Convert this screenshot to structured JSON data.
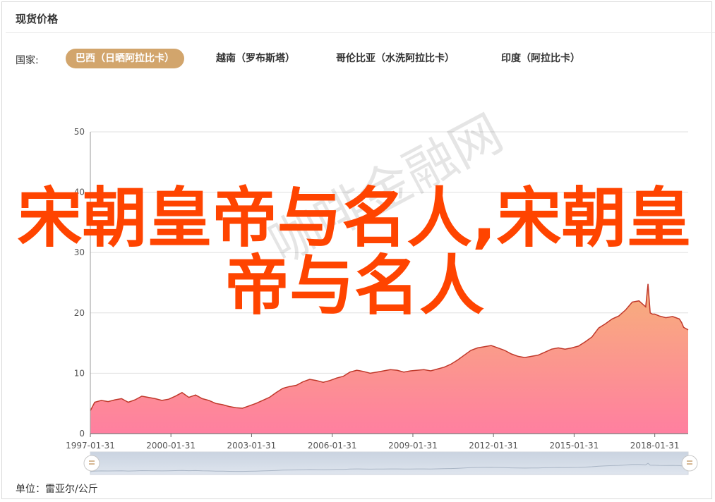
{
  "title": "现货价格",
  "country_label": "国家:",
  "countries": [
    {
      "label": "巴西（日晒阿拉比卡）",
      "active": true
    },
    {
      "label": "越南（罗布斯塔）",
      "active": false
    },
    {
      "label": "哥伦比亚（水洗阿拉比卡）",
      "active": false
    },
    {
      "label": "印度（阿拉比卡）",
      "active": false
    }
  ],
  "unit": "单位：雷亚尔/公斤",
  "watermark": "咖啡金融网",
  "overlay_text": "宋朝皇帝与名人,宋朝皇帝与名人",
  "colors": {
    "accent": "#d2a56c",
    "line": "#c0392b",
    "fill_top": "#f7b07a",
    "fill_bottom": "#ff7fa0",
    "overlay": "#ff4400"
  },
  "chart_data": {
    "type": "area",
    "title": "",
    "xlabel": "",
    "ylabel": "",
    "ylim": [
      0,
      50
    ],
    "yticks": [
      0,
      10,
      20,
      30,
      40,
      50
    ],
    "xlim": [
      "1997-01-31",
      "2019-04-30"
    ],
    "xticks": [
      "1997-01-31",
      "2000-01-31",
      "2003-01-31",
      "2006-01-31",
      "2009-01-31",
      "2012-01-31",
      "2015-01-31",
      "2018-01-31"
    ],
    "grid": true,
    "series": [
      {
        "x": [
          "1997-01-31",
          "1997-03-31",
          "1997-06-30",
          "1997-09-30",
          "1997-12-31",
          "1998-03-31",
          "1998-06-30",
          "1998-09-30",
          "1998-12-31",
          "1999-03-31",
          "1999-06-30",
          "1999-09-30",
          "1999-12-31",
          "2000-03-31",
          "2000-06-30",
          "2000-09-30",
          "2000-12-31",
          "2001-03-31",
          "2001-06-30",
          "2001-09-30",
          "2001-12-31",
          "2002-03-31",
          "2002-06-30",
          "2002-09-30",
          "2002-12-31",
          "2003-03-31",
          "2003-06-30",
          "2003-09-30",
          "2003-12-31",
          "2004-03-31",
          "2004-06-30",
          "2004-09-30",
          "2004-12-31",
          "2005-03-31",
          "2005-06-30",
          "2005-09-30",
          "2005-12-31",
          "2006-03-31",
          "2006-06-30",
          "2006-09-30",
          "2006-12-31",
          "2007-03-31",
          "2007-06-30",
          "2007-09-30",
          "2007-12-31",
          "2008-03-31",
          "2008-06-30",
          "2008-09-30",
          "2008-12-31",
          "2009-03-31",
          "2009-06-30",
          "2009-09-30",
          "2009-12-31",
          "2010-03-31",
          "2010-06-30",
          "2010-09-30",
          "2010-12-31",
          "2011-03-31",
          "2011-06-30",
          "2011-09-30",
          "2011-12-31",
          "2012-03-31",
          "2012-06-30",
          "2012-09-30",
          "2012-12-31",
          "2013-03-31",
          "2013-06-30",
          "2013-09-30",
          "2013-12-31",
          "2014-03-31",
          "2014-06-30",
          "2014-09-30",
          "2014-12-31",
          "2015-03-31",
          "2015-06-30",
          "2015-09-30",
          "2015-12-31",
          "2016-03-31",
          "2016-06-30",
          "2016-09-30",
          "2016-12-31",
          "2017-03-31",
          "2017-06-30",
          "2017-09-30",
          "2017-10-31",
          "2017-11-30",
          "2017-12-31",
          "2018-01-31",
          "2018-03-31",
          "2018-06-30",
          "2018-09-30",
          "2018-12-31",
          "2019-01-31",
          "2019-02-28",
          "2019-03-31",
          "2019-04-30"
        ],
        "values": [
          3.8,
          5.2,
          5.5,
          5.3,
          5.6,
          5.8,
          5.2,
          5.6,
          6.2,
          6.0,
          5.8,
          5.5,
          5.7,
          6.2,
          6.8,
          6.0,
          6.4,
          5.8,
          5.5,
          5.0,
          4.8,
          4.5,
          4.3,
          4.2,
          4.6,
          5.0,
          5.5,
          6.0,
          6.8,
          7.5,
          7.8,
          8.0,
          8.6,
          9.0,
          8.8,
          8.5,
          8.8,
          9.2,
          9.5,
          10.2,
          10.5,
          10.3,
          10.0,
          10.2,
          10.4,
          10.6,
          10.5,
          10.2,
          10.4,
          10.5,
          10.6,
          10.4,
          10.7,
          11.0,
          11.5,
          12.2,
          13.0,
          13.8,
          14.2,
          14.4,
          14.6,
          14.2,
          13.8,
          13.2,
          12.8,
          12.6,
          12.8,
          13.0,
          13.5,
          14.0,
          14.2,
          14.0,
          14.2,
          14.5,
          15.2,
          16.0,
          17.5,
          18.2,
          19.0,
          19.5,
          20.5,
          21.8,
          22.0,
          21.0,
          24.8,
          20.0,
          19.8,
          19.8,
          19.5,
          19.2,
          19.4,
          19.0,
          18.4,
          17.6,
          17.4,
          17.2
        ]
      }
    ]
  }
}
